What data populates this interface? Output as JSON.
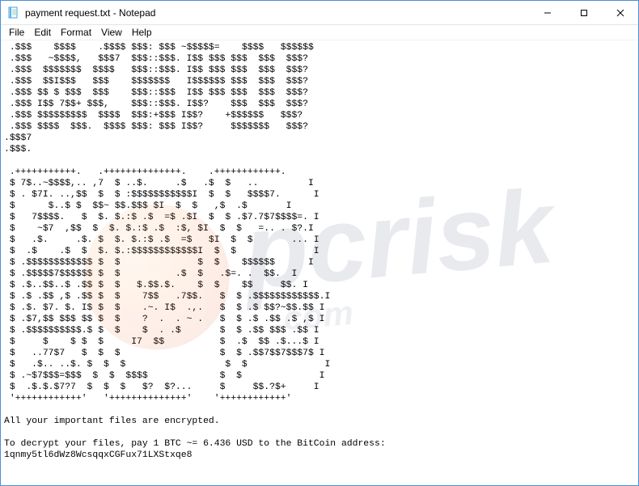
{
  "window": {
    "title": "payment request.txt - Notepad",
    "icon": "notepad-icon"
  },
  "menubar": {
    "items": [
      "File",
      "Edit",
      "Format",
      "View",
      "Help"
    ]
  },
  "document": {
    "body": " .$$$    $$$$    .$$$$ $$$: $$$ ~$$$$$=    $$$$   $$$$$$\n .$$$   ~$$$$,   $$$7  $$$::$$$. I$$ $$$ $$$  $$$  $$$?\n .$$$  $$$$$$$  $$$$   $$$::$$$. I$$ $$$ $$$  $$$  $$$?\n .$$$  $$I$$$   $$$    $$$$$$$   I$$$$$$ $$$  $$$  $$$?\n .$$$ $$ $ $$$  $$$    $$$::$$$  I$$ $$$ $$$  $$$  $$$?\n .$$$ I$$ 7$$+ $$$,    $$$::$$$. I$$?    $$$  $$$  $$$?\n .$$$ $$$$$$$$$  $$$$  $$$:+$$$ I$$?    +$$$$$$   $$$?\n .$$$ $$$$  $$$.  $$$$ $$$: $$$ I$$?     $$$$$$$   $$$?\n.$$$7\n.$$$.\n\n .+++++++++++.   .++++++++++++++.    .++++++++++++.\n $ 7$..~$$$$,.. ,7  $ ..$.     .$   .$  $   ..         I\n $ . $7I. ..,$$  $  $ :$$$$$$$$$$$I  $  $   $$$$7.      I\n $      $..$ $  $$~ $$.$$$ $I  $  $   ,$  .$       I\n $   7$$$$.   $  $. $.:$ .$  =$ .$I  $  $ .$7.7$7$$$$=. I\n $    ~$7  ,$$  $  $. $.:$ .$  :$, $I  $  $   =.. . $?.I\n $   .$.     .$. $  $. $.:$ .$  =$   $I  $  $       ... I\n $  .$    .$  $  $. $.:$$$$$$$$$$$$I  $  $              I\n $ .$$$$$$$$$$$$ $  $              $  $    $$$$$$      I\n $ .$$$$$7$$$$$$ $  $          .$  $   .$=. .  $$.  I\n $ .$..$$..$ .$$ $  $   $.$$.$.    $  $    $$     $$. I\n $ .$ .$$ ,$ .$$ $  $    7$$   .7$$.   $  $ .$$$$$$$$$$$$.I\n $ .$. $7. $. I$ $  $    .~. I$  .,.   $  $ .$ $$?~$$.$$ I\n $ .$7,$$ $$$ $$ $  $    ?  .  . ~ .   $  $ .$ .$$ .$ ,$ I\n $ .$$$$$$$$$$.$ $  $    $  . .$       $  $ .$$ $$$ .$$ I\n $     $    $ $  $     I7  $$          $  .$  $$ .$...$ I\n $   ..77$7   $  $  $                  $  $ .$$7$$7$$$7$ I\n $   .$.. ..$. $  $  $                  $  $              I\n $ .~$7$$$=$$$  $  $  $$$$             $  $              I\n $  .$.$.$7?7  $  $  $   $?  $?...     $     $$.?$+     I\n '++++++++++++'   '++++++++++++++'    '++++++++++++'\n\nAll your important files are encrypted.\n\nTo decrypt your files, pay 1 BTC ~= 6.436 USD to the BitCoin address:\n1qnmy5tl6dWz8WcsqqxCGFux71LXStxqe8"
  },
  "watermark": {
    "text": "pcrisk",
    "sub": ".com"
  }
}
